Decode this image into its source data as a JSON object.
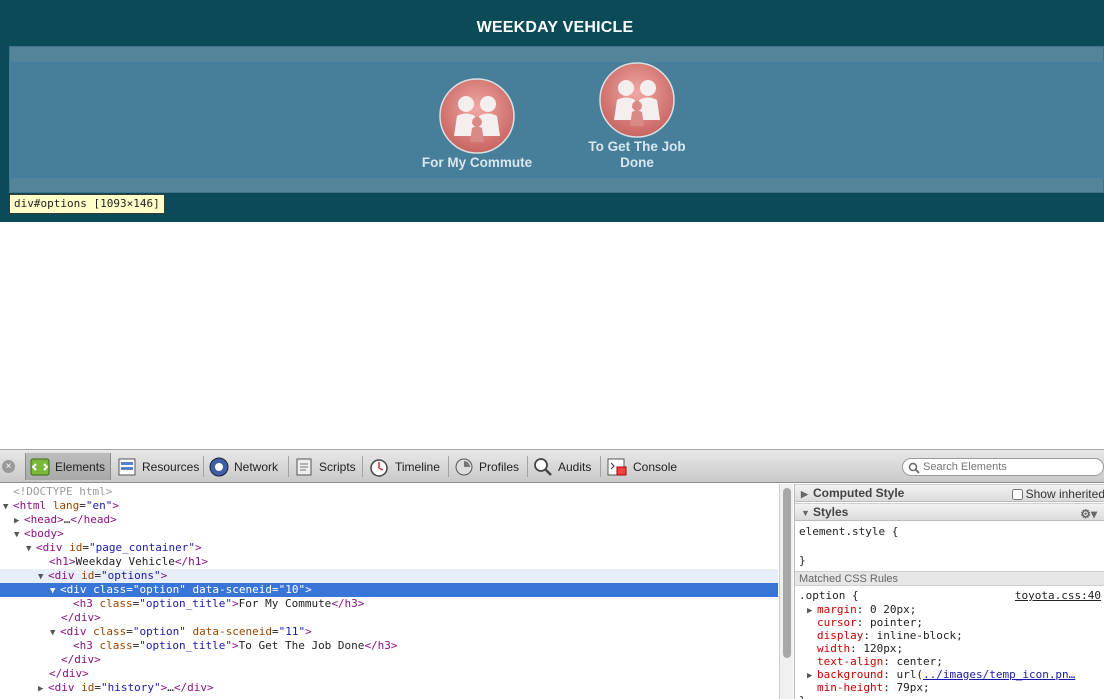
{
  "page": {
    "title": "WEEKDAY VEHICLE",
    "options": [
      {
        "title": "For My Commute"
      },
      {
        "title": "To Get The Job Done"
      }
    ],
    "tooltip": "div#options [1093×146]"
  },
  "devtools": {
    "tabs": [
      {
        "label": "Elements",
        "icon": "elements-icon"
      },
      {
        "label": "Resources",
        "icon": "resources-icon"
      },
      {
        "label": "Network",
        "icon": "network-icon"
      },
      {
        "label": "Scripts",
        "icon": "scripts-icon"
      },
      {
        "label": "Timeline",
        "icon": "timeline-icon"
      },
      {
        "label": "Profiles",
        "icon": "profiles-icon"
      },
      {
        "label": "Audits",
        "icon": "audits-icon"
      },
      {
        "label": "Console",
        "icon": "console-icon"
      }
    ],
    "search_placeholder": "Search Elements",
    "dom": {
      "doctype": "<!DOCTYPE html>",
      "html_tag": "html",
      "html_attr": "lang",
      "html_attr_val": "\"en\"",
      "head_open": "<head>",
      "ellipsis": "…",
      "head_close": "</head>",
      "body_open": "<body>",
      "div_tag": "div",
      "id_attr": "id",
      "class_attr": "class",
      "scene_attr": "data-sceneid",
      "page_container_val": "\"page_container\"",
      "h1_open": "<h1>",
      "h1_text": "Weekday Vehicle",
      "h1_close": "</h1>",
      "options_val": "\"options\"",
      "option_val": "\"option\"",
      "scene10_val": "\"10\"",
      "scene11_val": "\"11\"",
      "h3_tag": "h3",
      "option_title_val": "\"option_title\"",
      "h3_text1": "For My Commute",
      "h3_text2": "To Get The Job Done",
      "h3_close": "</h3>",
      "div_close": "</div>",
      "history_val": "\"history\"",
      "lt": "<",
      "gt": ">",
      "eq": "="
    },
    "sidebar": {
      "computed_style": "Computed Style",
      "show_inherited": "Show inherited",
      "styles": "Styles",
      "element_style_open": "element.style {",
      "element_style_close": "}",
      "matched_css_rules": "Matched CSS Rules",
      "rule_selector": ".option {",
      "rule_source": "toyota.css:40",
      "declarations": [
        {
          "prop": "margin",
          "value": ": 0 20px;",
          "expandable": true
        },
        {
          "prop": "cursor",
          "value": ": pointer;",
          "expandable": false
        },
        {
          "prop": "display",
          "value": ": inline-block;",
          "expandable": false
        },
        {
          "prop": "width",
          "value": ": 120px;",
          "expandable": false
        },
        {
          "prop": "text-align",
          "value": ": center;",
          "expandable": false
        },
        {
          "prop": "background",
          "value": ": url(",
          "url": "../images/temp_icon.pn…",
          "expandable": true
        },
        {
          "prop": "min-height",
          "value": ": 79px;",
          "expandable": false
        }
      ],
      "rule_close": "}"
    }
  }
}
